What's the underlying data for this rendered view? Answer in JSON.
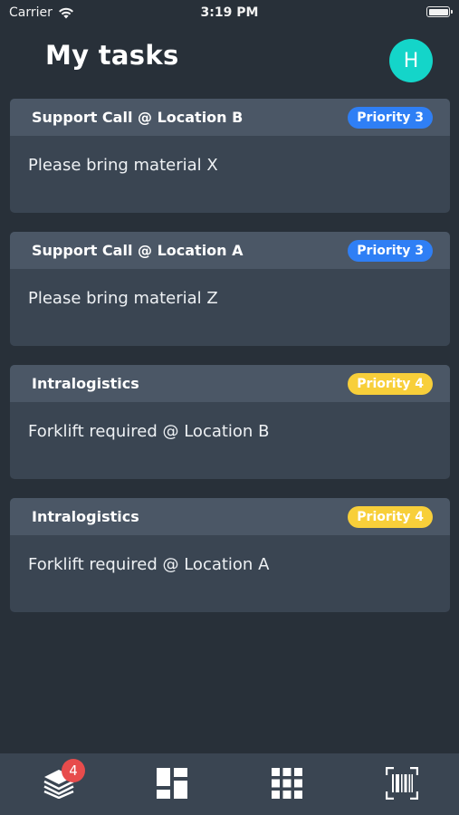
{
  "status_bar": {
    "carrier": "Carrier",
    "time": "3:19 PM"
  },
  "header": {
    "title": "My tasks",
    "avatar_initial": "H"
  },
  "tasks": [
    {
      "title": "Support Call @ Location B",
      "priority": "Priority 3",
      "description": "Please bring material X"
    },
    {
      "title": "Support Call @ Location A",
      "priority": "Priority 3",
      "description": "Please bring material Z"
    },
    {
      "title": "Intralogistics",
      "priority": "Priority 4",
      "description": "Forklift required @ Location B"
    },
    {
      "title": "Intralogistics",
      "priority": "Priority 4",
      "description": "Forklift required @ Location A"
    }
  ],
  "tab_bar": {
    "tabs": [
      {
        "icon": "layers-icon",
        "badge": "4"
      },
      {
        "icon": "dashboard-icon"
      },
      {
        "icon": "grid-icon"
      },
      {
        "icon": "barcode-scan-icon"
      }
    ]
  },
  "colors": {
    "background": "#283039",
    "card": "#3a4552",
    "card_header": "#4b5766",
    "priority_3": "#2f7ff5",
    "priority_4": "#f8cf3a",
    "avatar": "#14d5c9",
    "notification": "#e74c4c"
  }
}
